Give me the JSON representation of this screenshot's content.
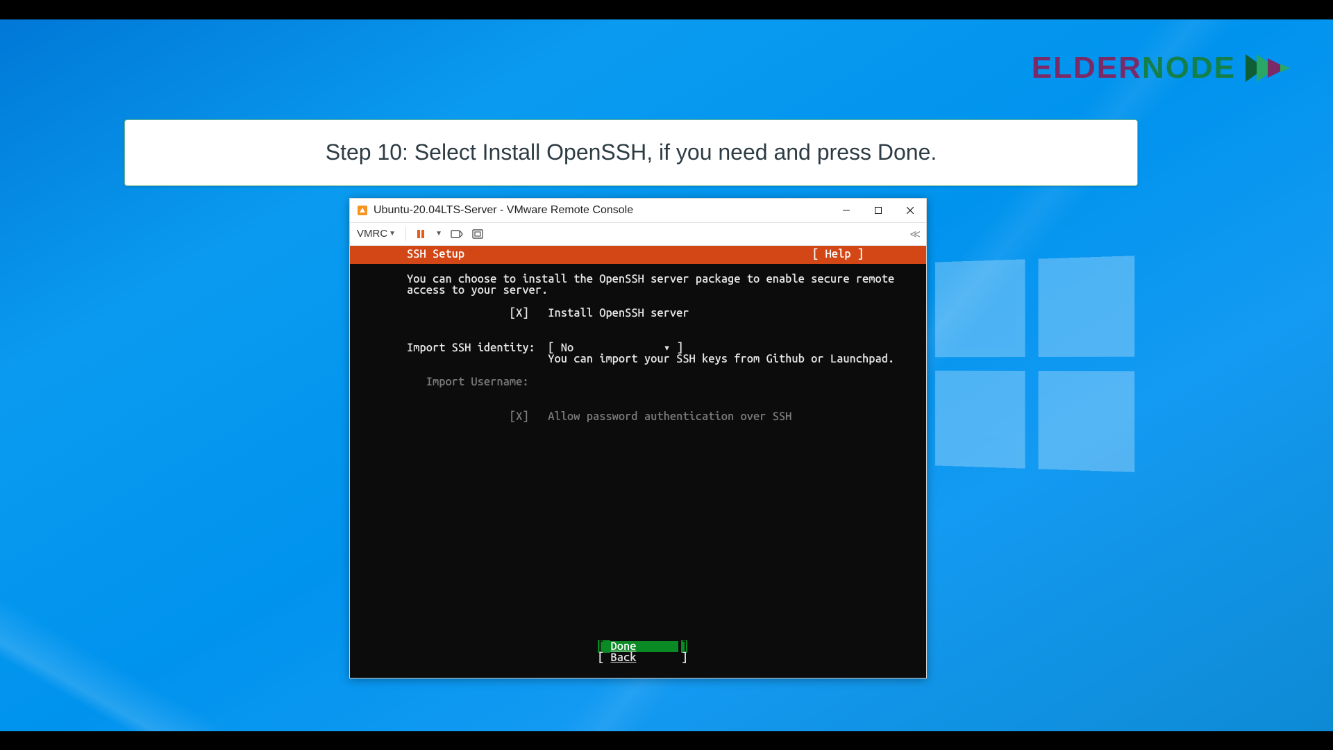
{
  "brand": {
    "elder": "ELDER",
    "node": "NODE"
  },
  "instruction": "Step 10: Select Install OpenSSH, if you need and press Done.",
  "vmrc": {
    "title": "Ubuntu-20.04LTS-Server - VMware Remote Console",
    "menu_label": "VMRC"
  },
  "installer": {
    "header_title": "SSH Setup",
    "header_help": "[ Help ]",
    "intro_l1": "You can choose to install the OpenSSH server package to enable secure remote",
    "intro_l2": "access to your server.",
    "install_row": "                [X]   Install OpenSSH server",
    "import_label": "Import SSH identity:  ",
    "import_value": "[ No              ▾ ]",
    "import_hint": "                      You can import your SSH keys from Github or Launchpad.",
    "username_row": "   Import Username:",
    "allow_row": "                [X]   Allow password authentication over SSH",
    "done_label": "Done",
    "back_label": "Back"
  }
}
